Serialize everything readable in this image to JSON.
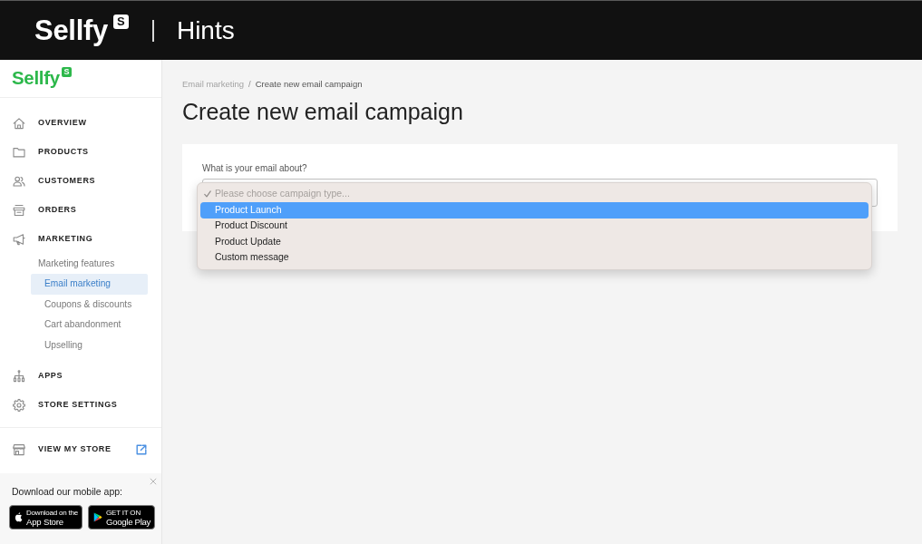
{
  "header": {
    "logo": "Sellfy",
    "logo_mark": "S",
    "title": "Hints"
  },
  "sidebar": {
    "logo": "Sellfy",
    "logo_mark": "S",
    "items": [
      {
        "label": "OVERVIEW"
      },
      {
        "label": "PRODUCTS"
      },
      {
        "label": "CUSTOMERS"
      },
      {
        "label": "ORDERS"
      },
      {
        "label": "MARKETING",
        "section": "Marketing features",
        "children": [
          {
            "label": "Email marketing",
            "selected": true
          },
          {
            "label": "Coupons & discounts",
            "selected": false
          },
          {
            "label": "Cart abandonment",
            "selected": false
          },
          {
            "label": "Upselling",
            "selected": false
          }
        ]
      },
      {
        "label": "APPS"
      },
      {
        "label": "STORE SETTINGS"
      }
    ],
    "store_link": "VIEW MY STORE",
    "app_promo": {
      "text": "Download our mobile app:",
      "badges": [
        {
          "kind": "apple",
          "caption": "Download on the",
          "label": "App Store"
        },
        {
          "kind": "google",
          "caption": "GET IT ON",
          "label": "Google Play"
        }
      ]
    }
  },
  "breadcrumb": {
    "items": [
      "Email marketing",
      "Create new email campaign"
    ],
    "separator": "/"
  },
  "title": "Create new email campaign",
  "form": {
    "label": "What is your email about?",
    "select": {
      "open": true,
      "options": [
        {
          "label": "Please choose campaign type...",
          "selected": true,
          "highlighted": false,
          "disabled": true
        },
        {
          "label": "Product Launch",
          "selected": false,
          "highlighted": true,
          "disabled": false
        },
        {
          "label": "Product Discount",
          "selected": false,
          "highlighted": false,
          "disabled": false
        },
        {
          "label": "Product Update",
          "selected": false,
          "highlighted": false,
          "disabled": false
        },
        {
          "label": "Custom message",
          "selected": false,
          "highlighted": false,
          "disabled": false
        }
      ]
    }
  }
}
